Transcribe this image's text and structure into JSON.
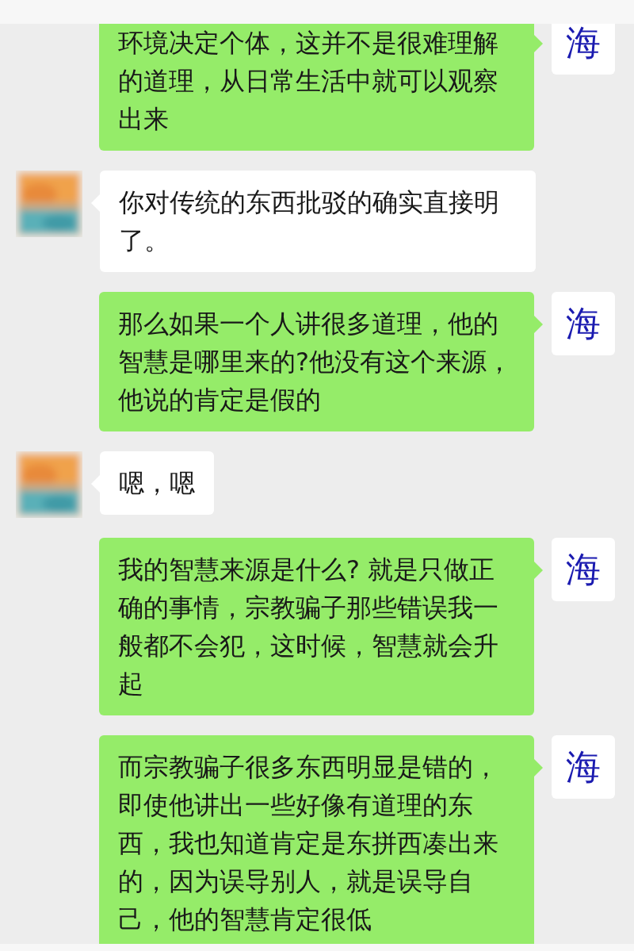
{
  "messages": [
    {
      "kind": "sent",
      "avatar_text": "海",
      "text": "环境决定个体，这并不是很难理解的道理，从日常生活中就可以观察出来"
    },
    {
      "kind": "received",
      "text": "你对传统的东西批驳的确实直接明了。"
    },
    {
      "kind": "sent",
      "avatar_text": "海",
      "text": "那么如果一个人讲很多道理，他的智慧是哪里来的?他没有这个来源，他说的肯定是假的"
    },
    {
      "kind": "received",
      "text": "嗯，嗯"
    },
    {
      "kind": "sent",
      "avatar_text": "海",
      "text": "我的智慧来源是什么? 就是只做正确的事情，宗教骗子那些错误我一般都不会犯，这时候，智慧就会升起"
    },
    {
      "kind": "sent",
      "avatar_text": "海",
      "text": "而宗教骗子很多东西明显是错的，即使他讲出一些好像有道理的东西，我也知道肯定是东拼西凑出来的，因为误导别人，就是误导自己，他的智慧肯定很低"
    }
  ]
}
